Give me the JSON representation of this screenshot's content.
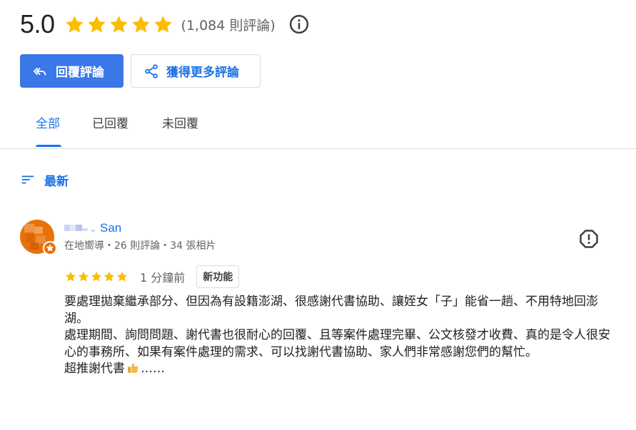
{
  "rating": {
    "score": "5.0",
    "count_text": "(1,084 則評論)",
    "stars": 5
  },
  "buttons": {
    "reply_label": "回覆評論",
    "get_more_label": "獲得更多評論"
  },
  "tabs": [
    {
      "label": "全部",
      "active": true
    },
    {
      "label": "已回覆",
      "active": false
    },
    {
      "label": "未回覆",
      "active": false
    }
  ],
  "sort": {
    "label": "最新"
  },
  "review": {
    "reviewer_name": "San",
    "reviewer_meta": "在地嚮導・26 則評論・34 張相片",
    "stars": 5,
    "time": "1 分鐘前",
    "new_badge": "新功能",
    "paragraphs": [
      "要處理拋棄繼承部分、但因為有設籍澎湖、很感謝代書協助、讓姪女「子」能省一趟、不用特地回澎湖。",
      "處理期間、詢問問題、謝代書也很耐心的回覆、且等案件處理完畢、公文核發才收費、真的是令人很安心的事務所、如果有案件處理的需求、可以找謝代書協助、家人們非常感謝您們的幫忙。"
    ],
    "last_line_start": "超推謝代書",
    "last_line_end": "……"
  },
  "colors": {
    "accent": "#1a73e8",
    "primary_button": "#3b78e7",
    "star": "#fbbc04",
    "avatar": "#e8710a"
  },
  "icons": {
    "info": "info-icon",
    "reply": "reply-icon",
    "share": "share-icon",
    "sort": "sort-icon",
    "report": "report-icon",
    "local_guide": "star-badge-icon",
    "thumb": "thumbs-up-icon"
  }
}
